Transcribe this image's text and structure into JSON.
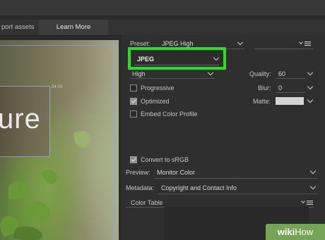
{
  "tabs": {
    "export_assets": "port assets",
    "learn_more": "Learn More"
  },
  "preview": {
    "overlay_text": "ure",
    "stamp": "04 03"
  },
  "settings": {
    "preset_label": "Preset:",
    "preset_value": "JPEG High",
    "format_value": "JPEG",
    "quality_level": "High",
    "quality_label": "Quality:",
    "quality_value": "60",
    "blur_label": "Blur:",
    "blur_value": "0",
    "matte_label": "Matte:",
    "matte_color": "#d4d4d4",
    "progressive_label": "Progressive",
    "progressive_checked": false,
    "optimized_label": "Optimized",
    "optimized_checked": true,
    "embed_label": "Embed Color Profile",
    "embed_checked": false,
    "convert_label": "Convert to sRGB",
    "convert_checked": true,
    "preview_label": "Preview:",
    "preview_value": "Monitor Color",
    "metadata_label": "Metadata:",
    "metadata_value": "Copyright and Contact Info",
    "color_table_label": "Color Table"
  },
  "watermark": {
    "wiki": "wiki",
    "how": "How"
  },
  "colors": {
    "highlight": "#25e21e",
    "panel_bg": "#2f2f2f",
    "watermark_bg": "#75a457"
  }
}
